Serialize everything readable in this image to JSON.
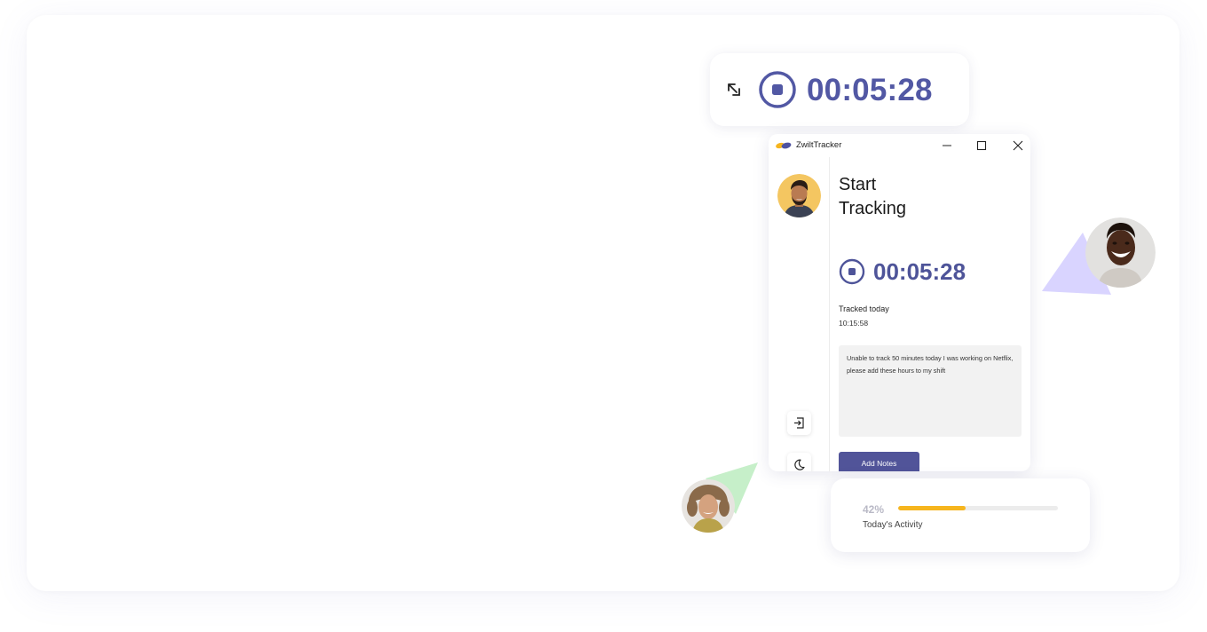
{
  "mini_timer": {
    "time": "00:05:28"
  },
  "app": {
    "window_title": "ZwiltTracker",
    "heading": "Start\nTracking",
    "timer": "00:05:28",
    "tracked_label": "Tracked today",
    "tracked_value": "10:15:58",
    "notes_text": "Unable to track 50 minutes today I was working on Netflix, please add these hours to my shift",
    "add_notes_label": "Add Notes"
  },
  "activity": {
    "percent_text": "42%",
    "percent": 42,
    "label": "Today's Activity"
  },
  "colors": {
    "accent": "#515499",
    "timer_text": "#5258a4",
    "progress_fill": "#f6b51e",
    "triangle_purple": "#d9d4ff",
    "triangle_green": "#c6efc9"
  },
  "icons": [
    "collapse-window-icon",
    "stop-icon",
    "zwilt-logo-icon",
    "minimize-icon",
    "maximize-icon",
    "close-icon",
    "logout-icon",
    "moon-icon"
  ]
}
